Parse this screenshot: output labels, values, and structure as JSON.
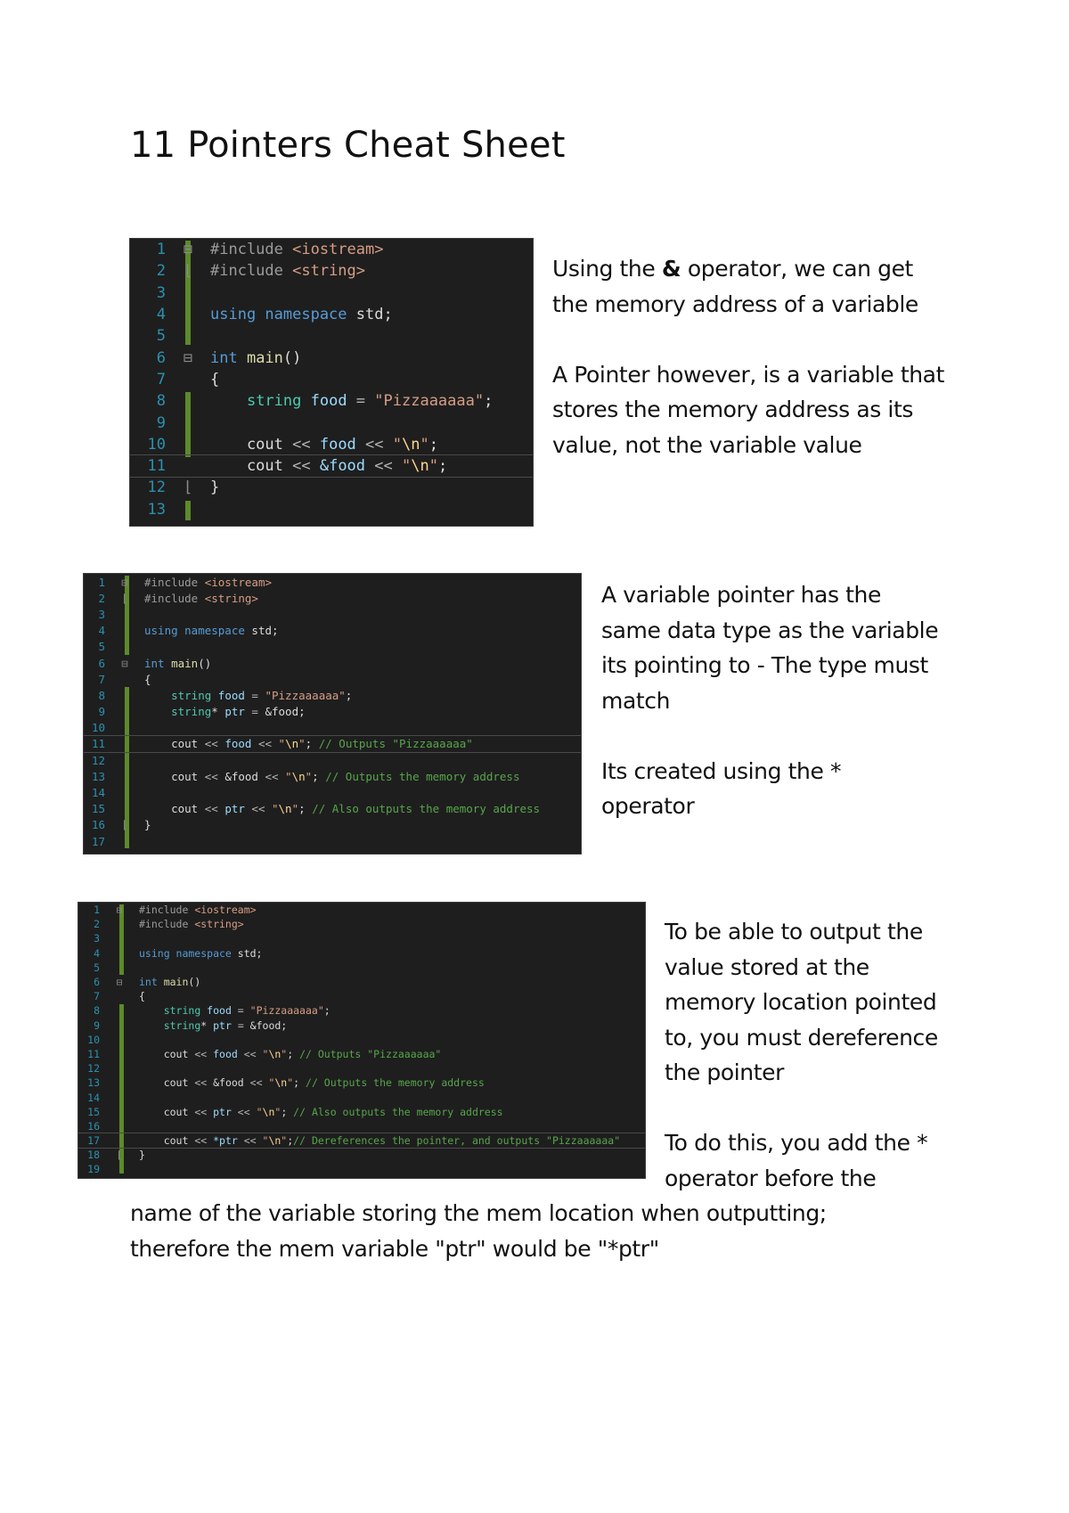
{
  "document": {
    "title": "11 Pointers Cheat Sheet"
  },
  "sections": [
    {
      "code": {
        "lines": [
          {
            "n": "1",
            "fold": "⊟",
            "tokens": [
              [
                "tok-pre",
                "#include "
              ],
              [
                "tok-inc",
                "<iostream>"
              ]
            ]
          },
          {
            "n": "2",
            "fold": "⌊",
            "tokens": [
              [
                "tok-pre",
                "#include "
              ],
              [
                "tok-inc",
                "<string>"
              ]
            ]
          },
          {
            "n": "3",
            "fold": "",
            "tokens": []
          },
          {
            "n": "4",
            "fold": "",
            "tokens": [
              [
                "tok-kw",
                "using namespace "
              ],
              [
                "tok-pl",
                "std;"
              ]
            ]
          },
          {
            "n": "5",
            "fold": "",
            "tokens": []
          },
          {
            "n": "6",
            "fold": "⊟",
            "tokens": [
              [
                "tok-kw",
                "int "
              ],
              [
                "tok-fn",
                "main"
              ],
              [
                "tok-pl",
                "()"
              ]
            ]
          },
          {
            "n": "7",
            "fold": "",
            "tokens": [
              [
                "tok-pl",
                "{"
              ]
            ]
          },
          {
            "n": "8",
            "fold": "",
            "tokens": [
              [
                "tok-pl",
                "    "
              ],
              [
                "tok-ty",
                "string "
              ],
              [
                "tok-id",
                "food"
              ],
              [
                "tok-op",
                " = "
              ],
              [
                "tok-str",
                "\"Pizzaaaaaa\""
              ],
              [
                "tok-pl",
                ";"
              ]
            ]
          },
          {
            "n": "9",
            "fold": "",
            "tokens": []
          },
          {
            "n": "10",
            "fold": "",
            "tokens": [
              [
                "tok-pl",
                "    cout "
              ],
              [
                "tok-op",
                "<< "
              ],
              [
                "tok-id",
                "food "
              ],
              [
                "tok-op",
                "<< "
              ],
              [
                "tok-str",
                "\""
              ],
              [
                "tok-esc",
                "\\n"
              ],
              [
                "tok-str",
                "\""
              ],
              [
                "tok-pl",
                ";"
              ]
            ]
          },
          {
            "n": "11",
            "fold": "",
            "highlight": true,
            "tokens": [
              [
                "tok-pl",
                "    cout "
              ],
              [
                "tok-op",
                "<< "
              ],
              [
                "tok-id",
                "&food "
              ],
              [
                "tok-op",
                "<< "
              ],
              [
                "tok-str",
                "\""
              ],
              [
                "tok-esc",
                "\\n"
              ],
              [
                "tok-str",
                "\""
              ],
              [
                "tok-pl",
                ";"
              ]
            ]
          },
          {
            "n": "12",
            "fold": "⌊",
            "tokens": [
              [
                "tok-pl",
                "}"
              ]
            ]
          },
          {
            "n": "13",
            "fold": "",
            "tokens": []
          }
        ]
      },
      "paragraphs": [
        {
          "parts": [
            {
              "text": "Using the ",
              "bold": false
            },
            {
              "text": "&",
              "bold": true
            },
            {
              "text": " operator, we can get the memory address of a variable",
              "bold": false
            }
          ]
        },
        {
          "parts": [
            {
              "text": "A Pointer however, is a variable that stores the memory address as its value, not the variable value",
              "bold": false
            }
          ]
        }
      ]
    },
    {
      "code": {
        "lines": [
          {
            "n": "1",
            "fold": "⊟",
            "tokens": [
              [
                "tok-pre",
                "#include "
              ],
              [
                "tok-inc",
                "<iostream>"
              ]
            ]
          },
          {
            "n": "2",
            "fold": "⌊",
            "tokens": [
              [
                "tok-pre",
                "#include "
              ],
              [
                "tok-inc",
                "<string>"
              ]
            ]
          },
          {
            "n": "3",
            "fold": "",
            "tokens": []
          },
          {
            "n": "4",
            "fold": "",
            "tokens": [
              [
                "tok-kw",
                "using namespace "
              ],
              [
                "tok-pl",
                "std;"
              ]
            ]
          },
          {
            "n": "5",
            "fold": "",
            "tokens": []
          },
          {
            "n": "6",
            "fold": "⊟",
            "tokens": [
              [
                "tok-kw",
                "int "
              ],
              [
                "tok-fn",
                "main"
              ],
              [
                "tok-pl",
                "()"
              ]
            ]
          },
          {
            "n": "7",
            "fold": "",
            "tokens": [
              [
                "tok-pl",
                "{"
              ]
            ]
          },
          {
            "n": "8",
            "fold": "",
            "tokens": [
              [
                "tok-pl",
                "    "
              ],
              [
                "tok-ty",
                "string "
              ],
              [
                "tok-id",
                "food"
              ],
              [
                "tok-op",
                " = "
              ],
              [
                "tok-str",
                "\"Pizzaaaaaa\""
              ],
              [
                "tok-pl",
                ";"
              ]
            ]
          },
          {
            "n": "9",
            "fold": "",
            "tokens": [
              [
                "tok-pl",
                "    "
              ],
              [
                "tok-ty",
                "string"
              ],
              [
                "tok-pl",
                "* "
              ],
              [
                "tok-id",
                "ptr"
              ],
              [
                "tok-op",
                " = "
              ],
              [
                "tok-pl",
                "&food;"
              ]
            ]
          },
          {
            "n": "10",
            "fold": "",
            "tokens": []
          },
          {
            "n": "11",
            "fold": "",
            "highlight": true,
            "tokens": [
              [
                "tok-pl",
                "    cout "
              ],
              [
                "tok-op",
                "<< "
              ],
              [
                "tok-id",
                "food "
              ],
              [
                "tok-op",
                "<< "
              ],
              [
                "tok-str",
                "\""
              ],
              [
                "tok-esc",
                "\\n"
              ],
              [
                "tok-str",
                "\""
              ],
              [
                "tok-pl",
                "; "
              ],
              [
                "tok-cm",
                "// Outputs \"Pizzaaaaaa\""
              ]
            ]
          },
          {
            "n": "12",
            "fold": "",
            "tokens": []
          },
          {
            "n": "13",
            "fold": "",
            "tokens": [
              [
                "tok-pl",
                "    cout "
              ],
              [
                "tok-op",
                "<< "
              ],
              [
                "tok-pl",
                "&food "
              ],
              [
                "tok-op",
                "<< "
              ],
              [
                "tok-str",
                "\""
              ],
              [
                "tok-esc",
                "\\n"
              ],
              [
                "tok-str",
                "\""
              ],
              [
                "tok-pl",
                "; "
              ],
              [
                "tok-cm",
                "// Outputs the memory address"
              ]
            ]
          },
          {
            "n": "14",
            "fold": "",
            "tokens": []
          },
          {
            "n": "15",
            "fold": "",
            "tokens": [
              [
                "tok-pl",
                "    cout "
              ],
              [
                "tok-op",
                "<< "
              ],
              [
                "tok-id",
                "ptr "
              ],
              [
                "tok-op",
                "<< "
              ],
              [
                "tok-str",
                "\""
              ],
              [
                "tok-esc",
                "\\n"
              ],
              [
                "tok-str",
                "\""
              ],
              [
                "tok-pl",
                "; "
              ],
              [
                "tok-cm",
                "// Also outputs the memory address"
              ]
            ]
          },
          {
            "n": "16",
            "fold": "⌊",
            "tokens": [
              [
                "tok-pl",
                "}"
              ]
            ]
          },
          {
            "n": "17",
            "fold": "",
            "tokens": []
          }
        ]
      },
      "paragraphs": [
        {
          "parts": [
            {
              "text": "A variable pointer has the same data type as the variable its pointing to - The type must match",
              "bold": false
            }
          ]
        },
        {
          "parts": [
            {
              "text": "Its created using the * operator",
              "bold": false
            }
          ]
        }
      ]
    },
    {
      "code": {
        "lines": [
          {
            "n": "1",
            "fold": "⊟",
            "tokens": [
              [
                "tok-pre",
                "#include "
              ],
              [
                "tok-inc",
                "<iostream>"
              ]
            ]
          },
          {
            "n": "2",
            "fold": "",
            "tokens": [
              [
                "tok-pre",
                "#include "
              ],
              [
                "tok-inc",
                "<string>"
              ]
            ]
          },
          {
            "n": "3",
            "fold": "",
            "tokens": []
          },
          {
            "n": "4",
            "fold": "",
            "tokens": [
              [
                "tok-kw",
                "using namespace "
              ],
              [
                "tok-pl",
                "std;"
              ]
            ]
          },
          {
            "n": "5",
            "fold": "",
            "tokens": []
          },
          {
            "n": "6",
            "fold": "⊟",
            "tokens": [
              [
                "tok-kw",
                "int "
              ],
              [
                "tok-fn",
                "main"
              ],
              [
                "tok-pl",
                "()"
              ]
            ]
          },
          {
            "n": "7",
            "fold": "",
            "tokens": [
              [
                "tok-pl",
                "{"
              ]
            ]
          },
          {
            "n": "8",
            "fold": "",
            "tokens": [
              [
                "tok-pl",
                "    "
              ],
              [
                "tok-ty",
                "string "
              ],
              [
                "tok-id",
                "food"
              ],
              [
                "tok-op",
                " = "
              ],
              [
                "tok-str",
                "\"Pizzaaaaaa\""
              ],
              [
                "tok-pl",
                ";"
              ]
            ]
          },
          {
            "n": "9",
            "fold": "",
            "tokens": [
              [
                "tok-pl",
                "    "
              ],
              [
                "tok-ty",
                "string"
              ],
              [
                "tok-pl",
                "* "
              ],
              [
                "tok-id",
                "ptr"
              ],
              [
                "tok-op",
                " = "
              ],
              [
                "tok-pl",
                "&food;"
              ]
            ]
          },
          {
            "n": "10",
            "fold": "",
            "tokens": []
          },
          {
            "n": "11",
            "fold": "",
            "tokens": [
              [
                "tok-pl",
                "    cout "
              ],
              [
                "tok-op",
                "<< "
              ],
              [
                "tok-id",
                "food "
              ],
              [
                "tok-op",
                "<< "
              ],
              [
                "tok-str",
                "\""
              ],
              [
                "tok-esc",
                "\\n"
              ],
              [
                "tok-str",
                "\""
              ],
              [
                "tok-pl",
                "; "
              ],
              [
                "tok-cm",
                "// Outputs \"Pizzaaaaaa\""
              ]
            ]
          },
          {
            "n": "12",
            "fold": "",
            "tokens": []
          },
          {
            "n": "13",
            "fold": "",
            "tokens": [
              [
                "tok-pl",
                "    cout "
              ],
              [
                "tok-op",
                "<< "
              ],
              [
                "tok-pl",
                "&food "
              ],
              [
                "tok-op",
                "<< "
              ],
              [
                "tok-str",
                "\""
              ],
              [
                "tok-esc",
                "\\n"
              ],
              [
                "tok-str",
                "\""
              ],
              [
                "tok-pl",
                "; "
              ],
              [
                "tok-cm",
                "// Outputs the memory address"
              ]
            ]
          },
          {
            "n": "14",
            "fold": "",
            "tokens": []
          },
          {
            "n": "15",
            "fold": "",
            "tokens": [
              [
                "tok-pl",
                "    cout "
              ],
              [
                "tok-op",
                "<< "
              ],
              [
                "tok-id",
                "ptr "
              ],
              [
                "tok-op",
                "<< "
              ],
              [
                "tok-str",
                "\""
              ],
              [
                "tok-esc",
                "\\n"
              ],
              [
                "tok-str",
                "\""
              ],
              [
                "tok-pl",
                "; "
              ],
              [
                "tok-cm",
                "// Also outputs the memory address"
              ]
            ]
          },
          {
            "n": "16",
            "fold": "",
            "tokens": []
          },
          {
            "n": "17",
            "fold": "",
            "highlight": true,
            "tokens": [
              [
                "tok-pl",
                "    cout "
              ],
              [
                "tok-op",
                "<< "
              ],
              [
                "tok-id",
                "*ptr "
              ],
              [
                "tok-op",
                "<< "
              ],
              [
                "tok-str",
                "\""
              ],
              [
                "tok-esc",
                "\\n"
              ],
              [
                "tok-str",
                "\""
              ],
              [
                "tok-pl",
                ";"
              ],
              [
                "tok-cm",
                "// Dereferences the pointer, and outputs \"Pizzaaaaaa\""
              ]
            ]
          },
          {
            "n": "18",
            "fold": "⌊",
            "tokens": [
              [
                "tok-pl",
                "}"
              ]
            ]
          },
          {
            "n": "19",
            "fold": "",
            "tokens": []
          }
        ]
      },
      "paragraphs": [
        {
          "parts": [
            {
              "text": "To be able to output the value stored at the memory location pointed to, you must dereference the pointer",
              "bold": false
            }
          ]
        },
        {
          "parts": [
            {
              "text": "To do this, you add the * operator before the",
              "bold": false
            }
          ]
        }
      ],
      "continuation": [
        "name of the variable storing the mem location when outputting;",
        "therefore the mem variable \"ptr\" would be \"*ptr\""
      ]
    }
  ]
}
